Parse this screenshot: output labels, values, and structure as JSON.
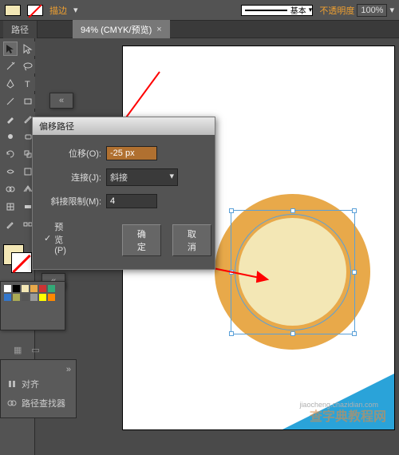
{
  "topbar": {
    "stroke_label": "描边",
    "stroke_style": "基本",
    "opacity_label": "不透明度",
    "opacity_value": "100%"
  },
  "tabs": {
    "path_tab": "路径",
    "doc_title": "94% (CMYK/预览)",
    "doc_close": "×"
  },
  "dialog": {
    "title": "偏移路径",
    "offset_label": "位移(O):",
    "offset_value": "-25 px",
    "join_label": "连接(J):",
    "join_value": "斜接",
    "miter_label": "斜接限制(M):",
    "miter_value": "4",
    "preview_label": "预览(P)",
    "ok": "确定",
    "cancel": "取消",
    "dropdown_caret": "▾"
  },
  "panels": {
    "align": "对齐",
    "pathfinder": "路径查找器",
    "expand": "«",
    "expand2": "»"
  },
  "watermark": {
    "sub": "jiaocheng.chazidian.com",
    "main": "查字典教程网"
  },
  "color_swatches": [
    "#fff",
    "#000",
    "#f3e7b5",
    "#e8a94a",
    "#c33",
    "#3a7",
    "#37c",
    "#aa5",
    "#555",
    "#999",
    "#ff0",
    "#f80"
  ],
  "canvas": {
    "outer_color": "#e8a94a",
    "inner_color": "#f3e7b5"
  }
}
